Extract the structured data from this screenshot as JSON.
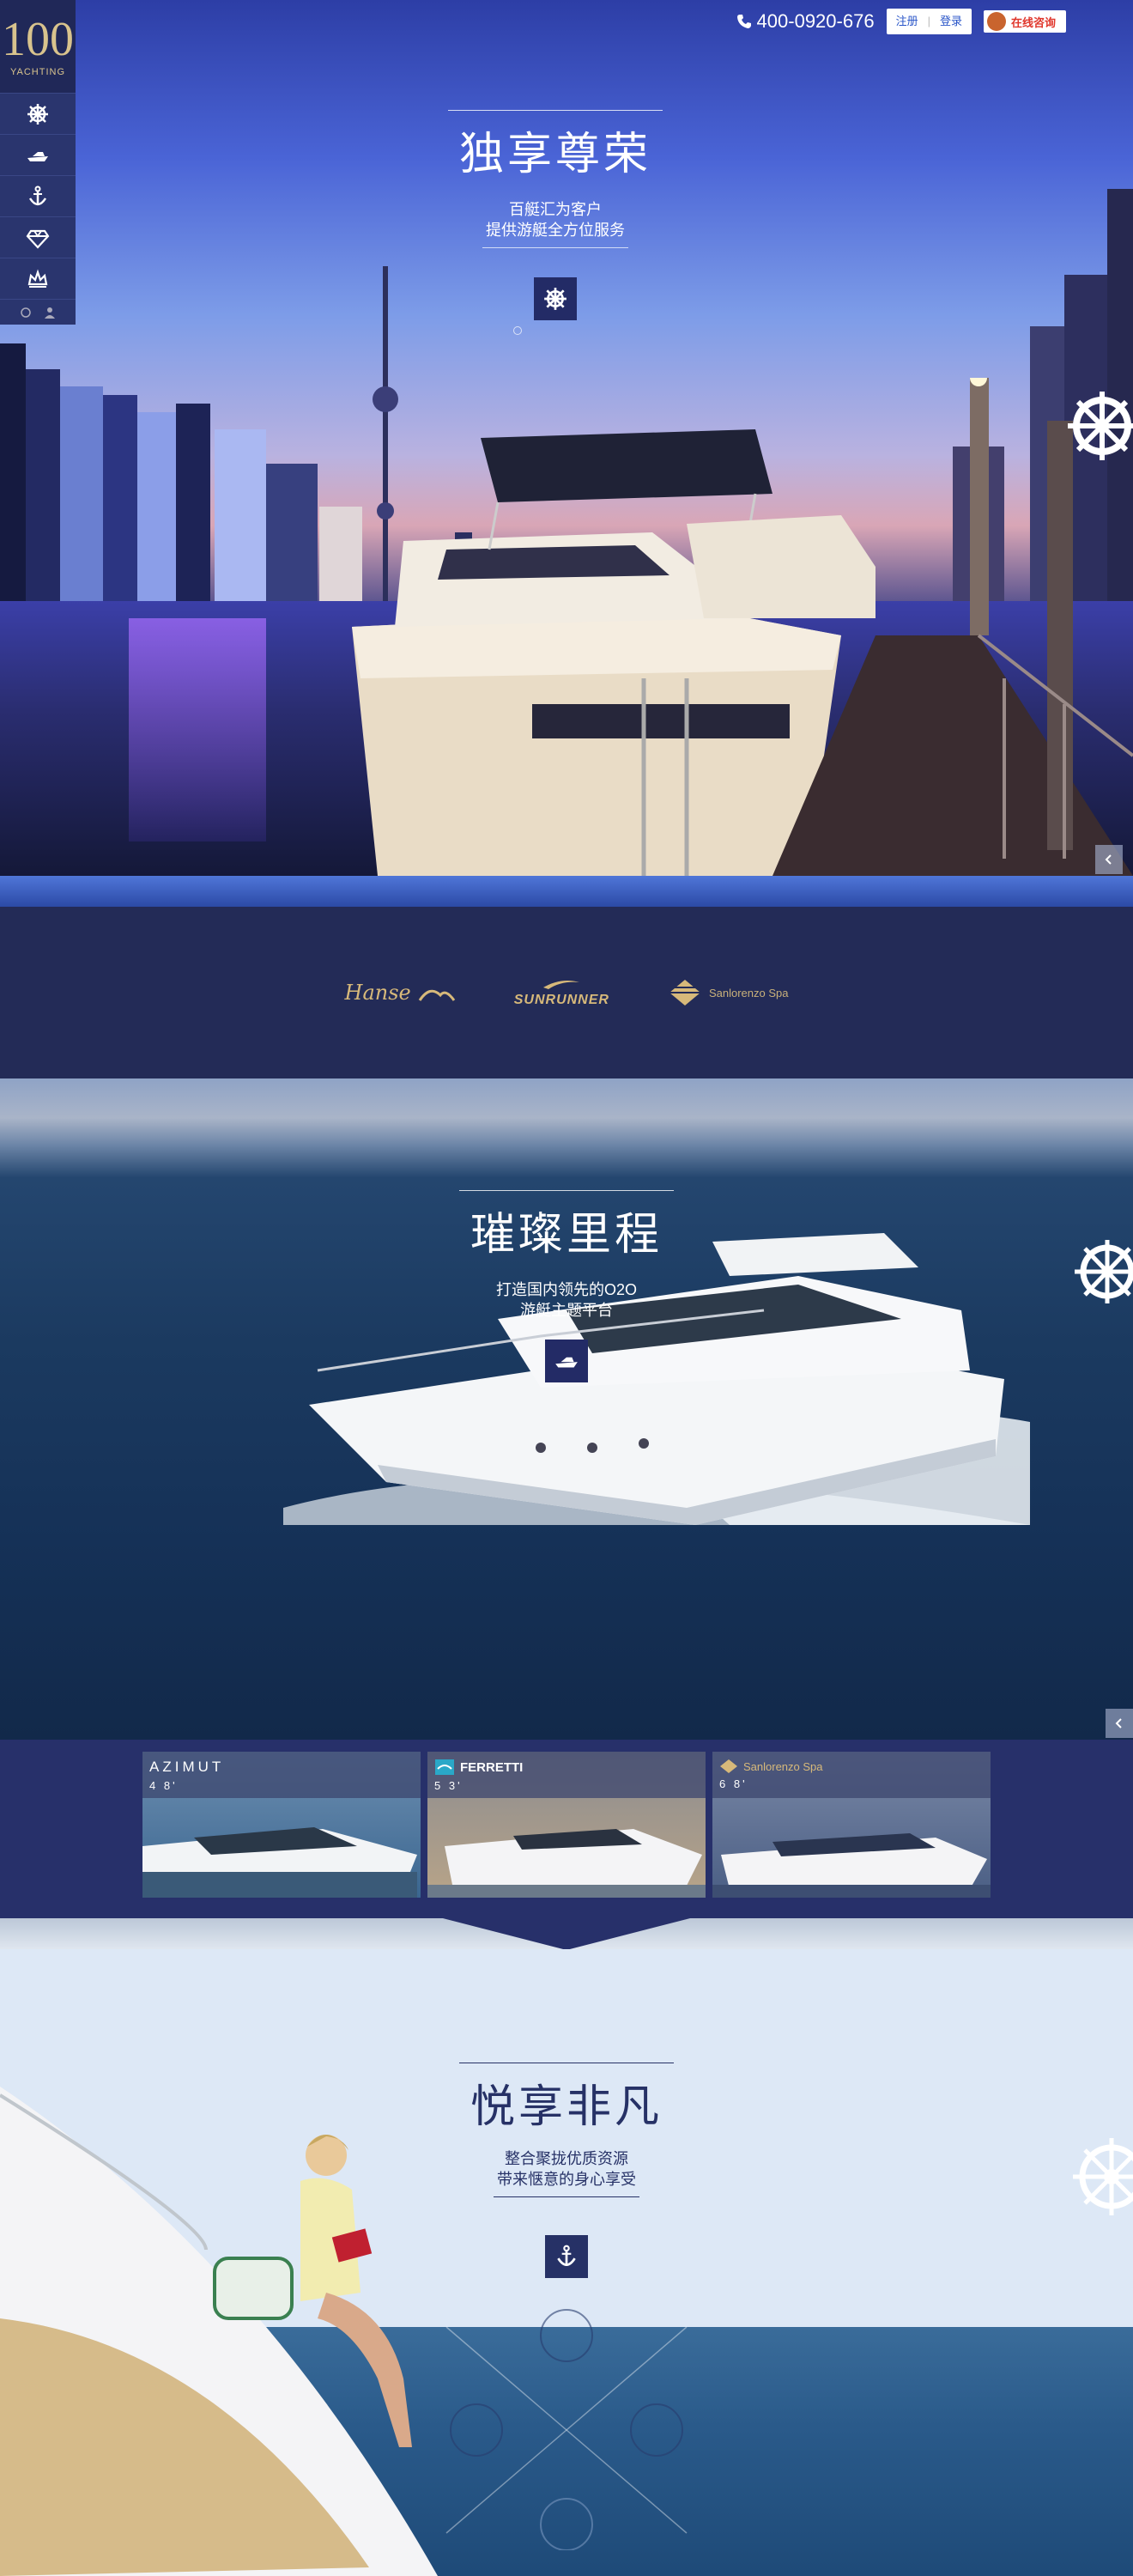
{
  "brand": {
    "logo_number": "100",
    "logo_text": "YACHTING"
  },
  "topbar": {
    "phone": "400-0920-676",
    "register": "注册",
    "login": "登录",
    "consult": "在线咨询"
  },
  "sidebar": {
    "items": [
      {
        "icon": "helm-icon"
      },
      {
        "icon": "yacht-icon"
      },
      {
        "icon": "anchor-icon"
      },
      {
        "icon": "diamond-icon"
      },
      {
        "icon": "crown-icon"
      }
    ]
  },
  "hero": {
    "title": "独享尊荣",
    "subtitle_1": "百艇汇为客户",
    "subtitle_2": "提供游艇全方位服务"
  },
  "brands": {
    "hanse": "Hanse",
    "sunrunner": "SUNRUNNER",
    "sanlorenzo": "Sanlorenzo Spa"
  },
  "section2": {
    "title": "璀璨里程",
    "subtitle_1": "打造国内领先的O2O",
    "subtitle_2": "游艇主题平台"
  },
  "thumbs": [
    {
      "brand": "AZIMUT",
      "size": "4 8'"
    },
    {
      "brand": "FERRETTI",
      "size": "5 3'"
    },
    {
      "brand": "Sanlorenzo Spa",
      "size": "6 8'"
    }
  ],
  "section3": {
    "title": "悦享非凡",
    "subtitle_1": "整合聚拢优质资源",
    "subtitle_2": "带来惬意的身心享受"
  },
  "colors": {
    "navy": "#232b57",
    "gold": "#d7b97a",
    "accent_blue": "#2a56c8"
  }
}
